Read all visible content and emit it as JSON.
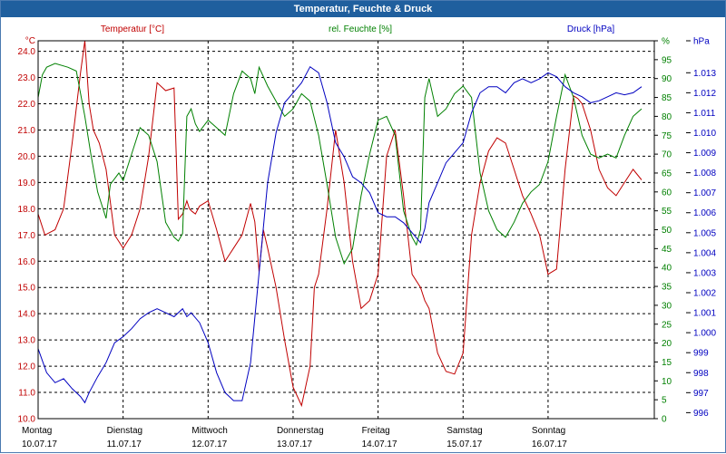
{
  "window": {
    "title": "Temperatur, Feuchte & Druck"
  },
  "chart_data": {
    "type": "line",
    "title": "Temperatur, Feuchte & Druck",
    "grid": true,
    "legend": [
      {
        "label": "Temperatur [°C]",
        "color": "#c00000"
      },
      {
        "label": "rel. Feuchte [%]",
        "color": "#008000"
      },
      {
        "label": "Druck [hPa]",
        "color": "#0000c0"
      }
    ],
    "axes": {
      "temperature": {
        "unit": "°C",
        "min": 10.0,
        "max": 24.4,
        "color": "#c00000",
        "ticks": [
          "10.0",
          "11.0",
          "12.0",
          "13.0",
          "14.0",
          "15.0",
          "16.0",
          "17.0",
          "18.0",
          "19.0",
          "20.0",
          "21.0",
          "22.0",
          "23.0",
          "24.0"
        ]
      },
      "humidity": {
        "unit": "%",
        "min": 0,
        "max": 100,
        "color": "#008000",
        "ticks": [
          "0",
          "5",
          "10",
          "15",
          "20",
          "25",
          "30",
          "35",
          "40",
          "45",
          "50",
          "55",
          "60",
          "65",
          "70",
          "75",
          "80",
          "85",
          "90",
          "95",
          "%"
        ]
      },
      "pressure": {
        "unit": "hPa",
        "min": 995.7,
        "max": 1014.6,
        "color": "#0000c0",
        "ticks": [
          "996",
          "997",
          "998",
          "999",
          "1.000",
          "1.001",
          "1.002",
          "1.003",
          "1.004",
          "1.005",
          "1.006",
          "1.007",
          "1.008",
          "1.009",
          "1.010",
          "1.011",
          "1.012",
          "1.013",
          "hPa"
        ]
      }
    },
    "x_days": [
      {
        "day": "Montag",
        "date": "10.07.17"
      },
      {
        "day": "Dienstag",
        "date": "11.07.17"
      },
      {
        "day": "Mittwoch",
        "date": "12.07.17"
      },
      {
        "day": "Donnerstag",
        "date": "13.07.17"
      },
      {
        "day": "Freitag",
        "date": "14.07.17"
      },
      {
        "day": "Samstag",
        "date": "15.07.17"
      },
      {
        "day": "Sonntag",
        "date": "16.07.17"
      }
    ],
    "x_range_days": [
      0,
      7.25
    ],
    "series": [
      {
        "name": "Temperatur [°C]",
        "axis": "temperature",
        "color": "#c00000",
        "x": [
          0,
          0.08,
          0.2,
          0.3,
          0.4,
          0.5,
          0.55,
          0.6,
          0.65,
          0.72,
          0.8,
          0.9,
          1.0,
          1.1,
          1.2,
          1.3,
          1.4,
          1.5,
          1.6,
          1.65,
          1.7,
          1.75,
          1.78,
          1.81,
          1.85,
          1.9,
          2.0,
          2.1,
          2.2,
          2.3,
          2.4,
          2.5,
          2.55,
          2.6,
          2.65,
          2.7,
          2.8,
          2.9,
          3.0,
          3.1,
          3.2,
          3.25,
          3.3,
          3.4,
          3.5,
          3.6,
          3.7,
          3.8,
          3.9,
          4.0,
          4.1,
          4.2,
          4.3,
          4.4,
          4.5,
          4.55,
          4.6,
          4.7,
          4.8,
          4.9,
          5.0,
          5.1,
          5.2,
          5.3,
          5.4,
          5.5,
          5.6,
          5.7,
          5.8,
          5.9,
          6.0,
          6.1,
          6.2,
          6.3,
          6.35,
          6.4,
          6.5,
          6.6,
          6.7,
          6.8,
          6.9,
          7.0,
          7.1
        ],
        "values": [
          17.8,
          17.0,
          17.2,
          18.0,
          20.5,
          23.2,
          24.4,
          22.0,
          21.0,
          20.5,
          19.5,
          17.0,
          16.5,
          17.0,
          18.0,
          20.0,
          22.8,
          22.5,
          22.6,
          17.6,
          17.8,
          18.3,
          18.0,
          17.9,
          17.8,
          18.1,
          18.3,
          17.2,
          16.0,
          16.5,
          17.0,
          18.2,
          17.5,
          15.6,
          17.2,
          16.5,
          15.0,
          13.0,
          11.2,
          10.5,
          12.0,
          15.0,
          15.5,
          18.0,
          21.0,
          19.0,
          16.0,
          14.2,
          14.5,
          15.5,
          20.0,
          21.0,
          18.5,
          15.5,
          15.0,
          14.5,
          14.2,
          12.5,
          11.8,
          11.7,
          12.5,
          17.0,
          19.0,
          20.2,
          20.7,
          20.5,
          19.5,
          18.5,
          17.8,
          17.0,
          15.5,
          15.7,
          19.5,
          22.3,
          22.2,
          22.0,
          21.0,
          19.5,
          18.8,
          18.5,
          19.0,
          19.5,
          19.1
        ]
      },
      {
        "name": "rel. Feuchte [%]",
        "axis": "humidity",
        "color": "#008000",
        "x": [
          0,
          0.05,
          0.1,
          0.2,
          0.35,
          0.45,
          0.55,
          0.62,
          0.7,
          0.8,
          0.85,
          0.95,
          1.0,
          1.1,
          1.2,
          1.3,
          1.4,
          1.5,
          1.6,
          1.65,
          1.7,
          1.75,
          1.8,
          1.85,
          1.9,
          2.0,
          2.1,
          2.2,
          2.3,
          2.4,
          2.5,
          2.55,
          2.6,
          2.7,
          2.8,
          2.9,
          3.0,
          3.1,
          3.2,
          3.3,
          3.4,
          3.5,
          3.6,
          3.7,
          3.8,
          3.9,
          4.0,
          4.1,
          4.2,
          4.3,
          4.4,
          4.45,
          4.5,
          4.55,
          4.6,
          4.7,
          4.8,
          4.9,
          5.0,
          5.1,
          5.2,
          5.3,
          5.4,
          5.5,
          5.6,
          5.7,
          5.8,
          5.9,
          6.0,
          6.1,
          6.2,
          6.3,
          6.4,
          6.5,
          6.6,
          6.7,
          6.8,
          6.9,
          7.0,
          7.05,
          7.1
        ],
        "values": [
          85,
          91,
          93,
          94,
          93,
          92,
          80,
          70,
          60,
          53,
          62,
          65,
          63,
          70,
          77,
          75,
          68,
          52,
          48,
          47,
          49,
          80,
          82,
          78,
          76,
          79,
          77,
          75,
          86,
          92,
          90,
          86,
          93,
          88,
          84,
          80,
          82,
          86,
          84,
          75,
          62,
          48,
          41,
          45,
          59,
          70,
          79,
          80,
          75,
          55,
          48,
          46,
          50,
          85,
          90,
          80,
          82,
          86,
          88,
          85,
          65,
          55,
          50,
          48,
          52,
          57,
          60,
          62,
          68,
          80,
          91,
          85,
          75,
          70,
          69,
          70,
          69,
          75,
          80,
          81,
          82
        ]
      },
      {
        "name": "Druck [hPa]",
        "axis": "pressure",
        "color": "#0000c0",
        "x": [
          0,
          0.1,
          0.2,
          0.3,
          0.4,
          0.5,
          0.55,
          0.6,
          0.7,
          0.8,
          0.9,
          1.0,
          1.1,
          1.2,
          1.3,
          1.4,
          1.5,
          1.6,
          1.7,
          1.75,
          1.8,
          1.9,
          2.0,
          2.1,
          2.2,
          2.3,
          2.4,
          2.5,
          2.6,
          2.7,
          2.8,
          2.9,
          3.0,
          3.1,
          3.2,
          3.3,
          3.4,
          3.5,
          3.6,
          3.7,
          3.8,
          3.9,
          4.0,
          4.1,
          4.2,
          4.3,
          4.4,
          4.5,
          4.55,
          4.6,
          4.7,
          4.8,
          4.9,
          5.0,
          5.1,
          5.2,
          5.3,
          5.4,
          5.5,
          5.6,
          5.7,
          5.8,
          5.9,
          6.0,
          6.1,
          6.2,
          6.3,
          6.4,
          6.5,
          6.6,
          6.7,
          6.8,
          6.9,
          7.0,
          7.1
        ],
        "values": [
          999.2,
          998.0,
          997.5,
          997.7,
          997.2,
          996.8,
          996.5,
          997.0,
          997.8,
          998.5,
          999.5,
          999.8,
          1000.2,
          1000.7,
          1001.0,
          1001.2,
          1001.0,
          1000.8,
          1001.2,
          1000.8,
          1001.0,
          1000.5,
          999.5,
          998.0,
          997.0,
          996.6,
          996.6,
          998.5,
          1003.0,
          1007.5,
          1010.0,
          1011.5,
          1012.0,
          1012.5,
          1013.3,
          1013.0,
          1011.5,
          1009.5,
          1008.8,
          1007.8,
          1007.5,
          1007.0,
          1006.0,
          1005.8,
          1005.8,
          1005.5,
          1005.0,
          1004.5,
          1005.2,
          1006.5,
          1007.5,
          1008.5,
          1009.0,
          1009.5,
          1011.0,
          1012.0,
          1012.3,
          1012.3,
          1012.0,
          1012.5,
          1012.7,
          1012.5,
          1012.7,
          1013.0,
          1012.8,
          1012.3,
          1012.0,
          1011.8,
          1011.5,
          1011.6,
          1011.8,
          1012.0,
          1011.9,
          1012.0,
          1012.3
        ]
      }
    ]
  }
}
